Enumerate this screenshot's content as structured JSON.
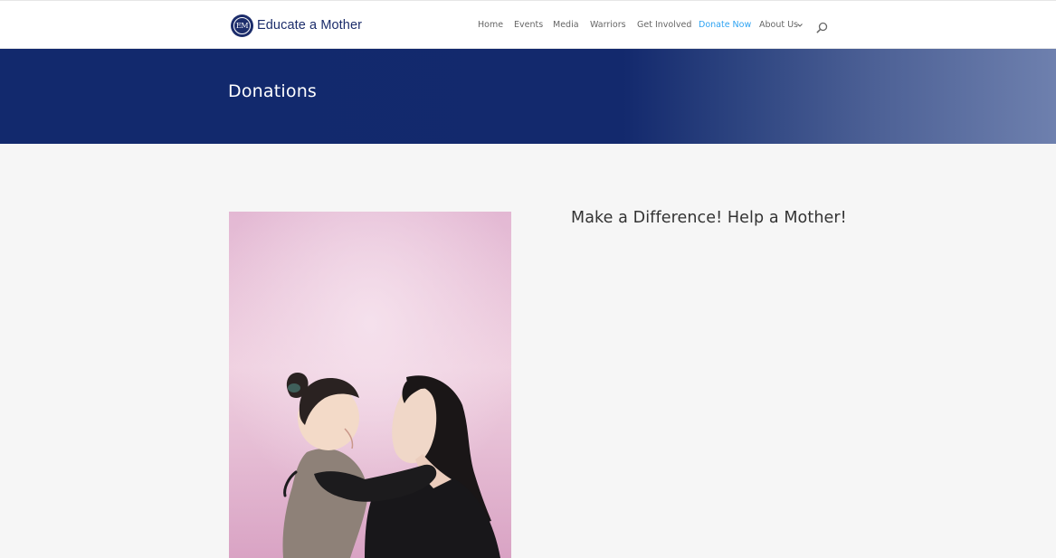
{
  "brand": {
    "name": "Educate a Mother",
    "seal_initials": "EM",
    "color": "#1c2d6b"
  },
  "nav": {
    "items": [
      {
        "label": "Home"
      },
      {
        "label": "Events"
      },
      {
        "label": "Media"
      },
      {
        "label": "Warriors"
      },
      {
        "label": "Get Involved"
      },
      {
        "label": "Donate Now",
        "active": true
      },
      {
        "label": "About Us",
        "has_dropdown": true
      }
    ],
    "chevron_icon": "chevron-down-icon",
    "search_icon": "search-icon",
    "active_color": "#2ea3f2"
  },
  "hero": {
    "title": "Donations",
    "color": "#12296d"
  },
  "main": {
    "heading": "Make a Difference! Help a Mother!",
    "photo_icon": "mother-and-daughter-photo"
  }
}
